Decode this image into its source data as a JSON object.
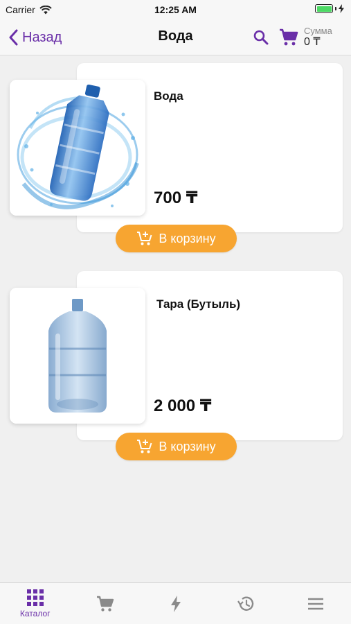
{
  "status_bar": {
    "carrier": "Carrier",
    "time": "12:25 AM",
    "battery_level": 1.0
  },
  "nav": {
    "back_label": "Назад",
    "title": "Вода",
    "cart_sum_label": "Сумма",
    "cart_sum_value": "0 ₸"
  },
  "products": [
    {
      "name": "Вода",
      "price": "700 ₸",
      "button_label": "В корзину",
      "image": "water-splash-bottle"
    },
    {
      "name": "Тара (Бутыль)",
      "price": "2 000 ₸",
      "button_label": "В корзину",
      "image": "empty-water-bottle"
    }
  ],
  "tab_bar": {
    "tabs": [
      {
        "label": "Каталог",
        "icon": "grid-icon",
        "active": true
      },
      {
        "label": "",
        "icon": "cart-icon",
        "active": false
      },
      {
        "label": "",
        "icon": "lightning-icon",
        "active": false
      },
      {
        "label": "",
        "icon": "history-icon",
        "active": false
      },
      {
        "label": "",
        "icon": "menu-icon",
        "active": false
      }
    ]
  },
  "colors": {
    "accent": "#6a2fa8",
    "button": "#f7a531",
    "inactive_icon": "#8a8a8a"
  }
}
